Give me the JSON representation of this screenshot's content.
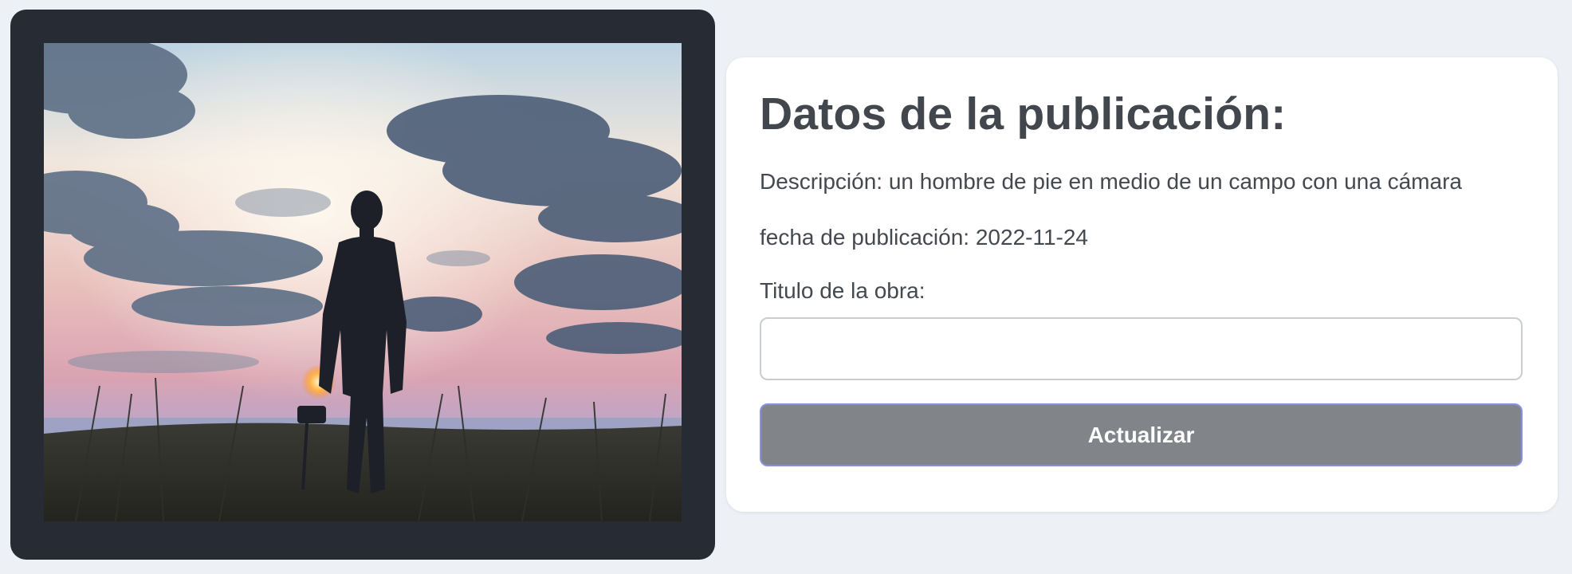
{
  "publication": {
    "title": "Datos de la publicación:",
    "description": "Descripción: un hombre de pie en medio de un campo con una cámara",
    "date": "fecha de publicación: 2022-11-24",
    "work_title_label": "Titulo de la obra:",
    "work_title_value": "",
    "update_label": "Actualizar"
  },
  "colors": {
    "page_background": "#edf0f4",
    "frame": "#272b33",
    "button": "#818489",
    "button_border": "#8b8fe0"
  }
}
